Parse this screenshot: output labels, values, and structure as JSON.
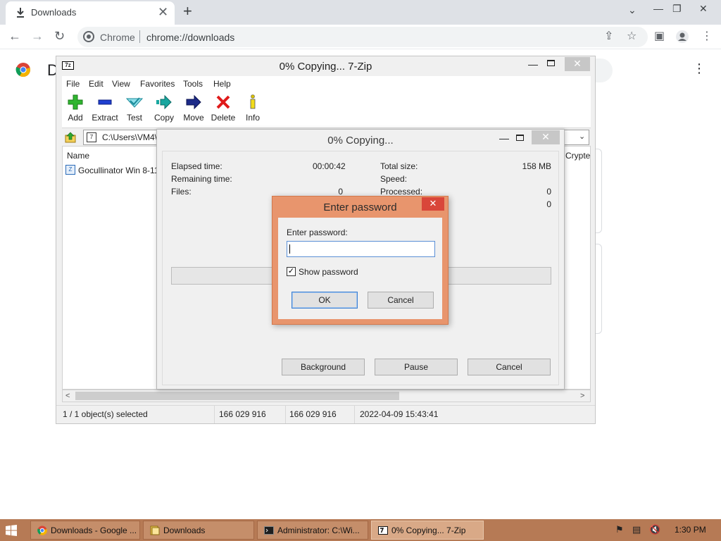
{
  "browser": {
    "tab_title": "Downloads",
    "tab_close": "✕",
    "new_tab": "+",
    "chip_label": "Chrome",
    "url": "chrome://downloads",
    "page_heading": "D",
    "win_min": "⌄",
    "win_dash": "—",
    "win_restore": "❐",
    "win_close": "✕",
    "more": "⋮"
  },
  "sevenzip": {
    "title": "0% Copying... 7-Zip",
    "icon_text": "7z",
    "menu": [
      "File",
      "Edit",
      "View",
      "Favorites",
      "Tools",
      "Help"
    ],
    "toolbar": [
      {
        "label": "Add",
        "icon": "add-icon"
      },
      {
        "label": "Extract",
        "icon": "extract-icon"
      },
      {
        "label": "Test",
        "icon": "test-icon"
      },
      {
        "label": "Copy",
        "icon": "copy-icon"
      },
      {
        "label": "Move",
        "icon": "move-icon"
      },
      {
        "label": "Delete",
        "icon": "delete-icon"
      },
      {
        "label": "Info",
        "icon": "info-icon"
      }
    ],
    "path": "C:\\Users\\VM4\\",
    "columns": {
      "name": "Name",
      "crypted": "Crypte"
    },
    "file_name": "Gocullinator Win 8-11",
    "status": {
      "selected": "1 / 1 object(s) selected",
      "size": "166 029 916",
      "packed": "166 029 916",
      "modified": "2022-04-09 15:43:41"
    }
  },
  "copy_dialog": {
    "title": "0% Copying...",
    "elapsed_label": "Elapsed time:",
    "elapsed_value": "00:00:42",
    "remaining_label": "Remaining time:",
    "files_label": "Files:",
    "files_value": "0",
    "total_size_label": "Total size:",
    "total_size_value": "158 MB",
    "speed_label": "Speed:",
    "processed_label": "Processed:",
    "processed_value": "0",
    "extra_value": "0",
    "progress": 0,
    "background_label": "Background",
    "pause_label": "Pause",
    "cancel_label": "Cancel"
  },
  "password_dialog": {
    "title": "Enter password",
    "field_label": "Enter password:",
    "field_value": "",
    "show_password_label": "Show password",
    "show_password_checked": true,
    "ok_label": "OK",
    "cancel_label": "Cancel"
  },
  "taskbar": {
    "items": [
      {
        "label": "Downloads - Google ...",
        "icon": "chrome-icon"
      },
      {
        "label": "Downloads",
        "icon": "folder-icon"
      },
      {
        "label": "Administrator: C:\\Wi...",
        "icon": "cmd-icon"
      },
      {
        "label": "0% Copying... 7-Zip",
        "icon": "sevenzip-icon"
      }
    ],
    "clock": "1:30 PM"
  },
  "colors": {
    "taskbar": "#b67a55",
    "dialog_frame": "#e8956d",
    "close_red": "#d9463a"
  }
}
